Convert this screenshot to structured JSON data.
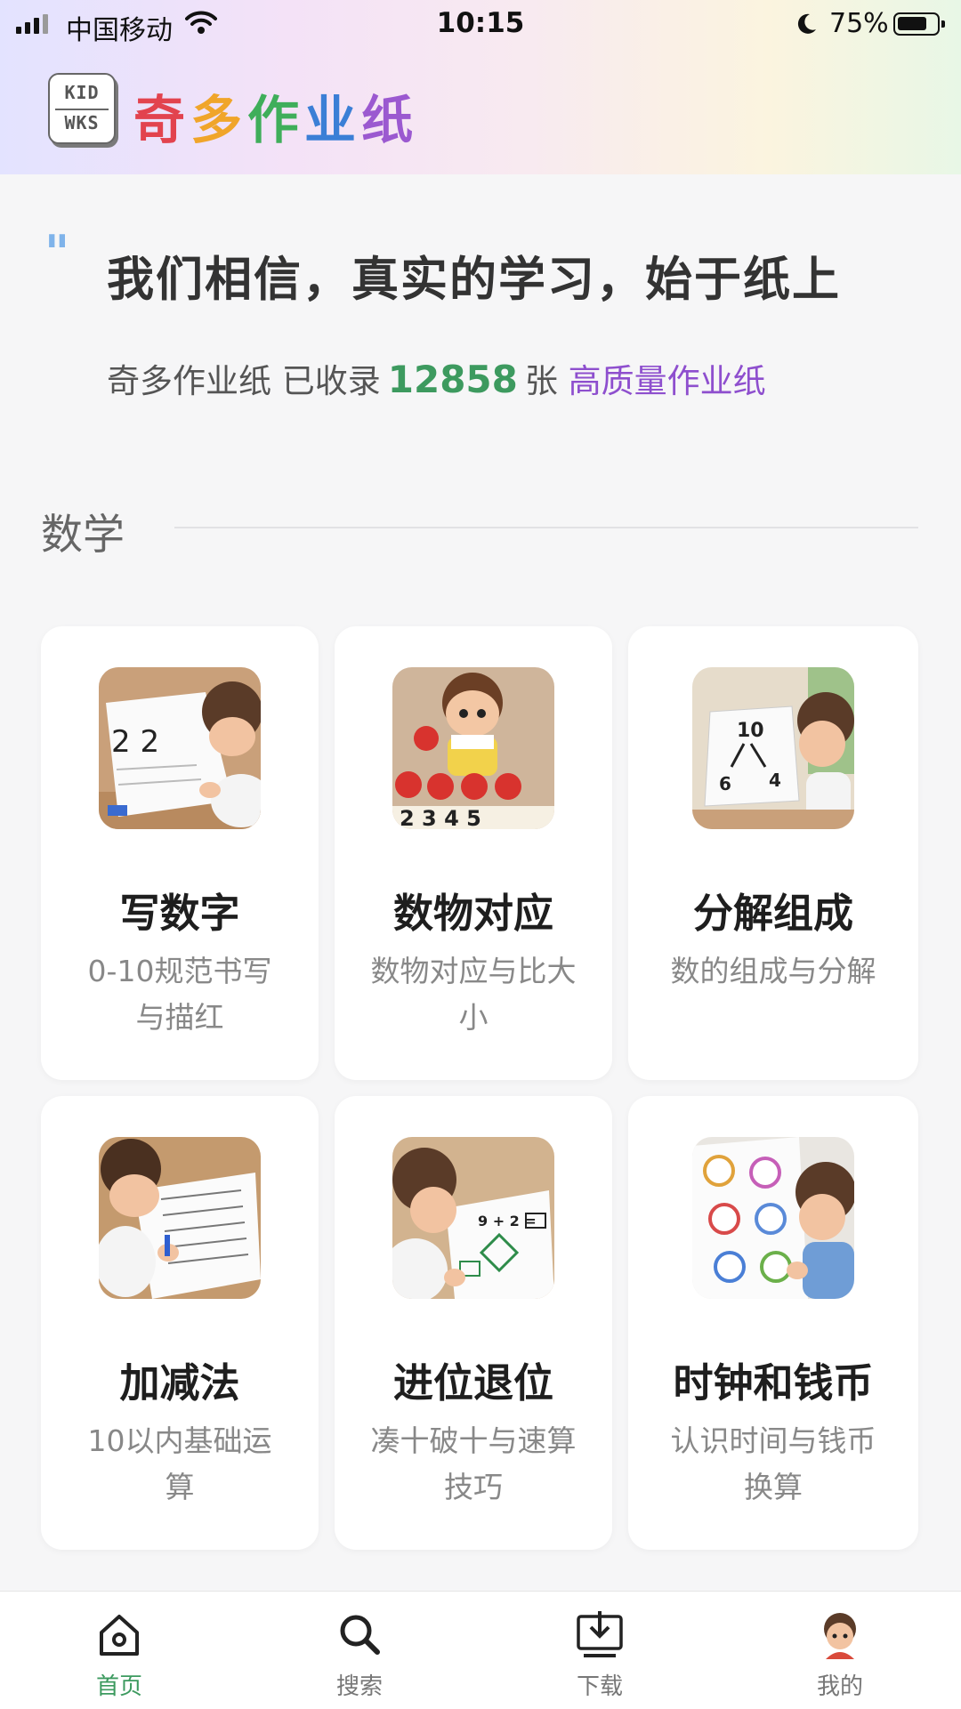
{
  "status_bar": {
    "carrier": "中国移动",
    "time": "10:15",
    "battery": "75%",
    "battery_level": 0.75
  },
  "header": {
    "logo_line1": "KID",
    "logo_line2": "WKS",
    "brand_chars": [
      "奇",
      "多",
      "作",
      "业",
      "纸"
    ],
    "brand_colors": [
      "#e2434e",
      "#f0a52a",
      "#3fae5a",
      "#3b7fd6",
      "#9b59d0"
    ]
  },
  "hero": {
    "quote_mark": "\"",
    "slogan": "我们相信，真实的学习，始于纸上",
    "stats_prefix": "奇多作业纸 已收录",
    "count": "12858",
    "stats_unit": "张",
    "stats_highlight": "高质量作业纸"
  },
  "section": {
    "title": "数学"
  },
  "cards": [
    {
      "title": "写数字",
      "desc": "0-10规范书写与描红",
      "icon": "writing-numbers-image"
    },
    {
      "title": "数物对应",
      "desc": "数物对应与比大小",
      "icon": "counting-apples-image"
    },
    {
      "title": "分解组成",
      "desc": "数的组成与分解",
      "icon": "number-bond-image"
    },
    {
      "title": "加减法",
      "desc": "10以内基础运算",
      "icon": "addition-worksheet-image"
    },
    {
      "title": "进位退位",
      "desc": "凑十破十与速算技巧",
      "icon": "carry-borrow-image"
    },
    {
      "title": "时钟和钱币",
      "desc": "认识时间与钱币换算",
      "icon": "clocks-image"
    }
  ],
  "nav": [
    {
      "label": "首页",
      "icon": "home-icon",
      "active": true
    },
    {
      "label": "搜索",
      "icon": "search-icon",
      "active": false
    },
    {
      "label": "下载",
      "icon": "download-icon",
      "active": false
    },
    {
      "label": "我的",
      "icon": "avatar-icon",
      "active": false
    }
  ],
  "colors": {
    "accent_green": "#3d9a5f",
    "accent_purple": "#8e4fce",
    "quote_blue": "#7fb3ea"
  }
}
